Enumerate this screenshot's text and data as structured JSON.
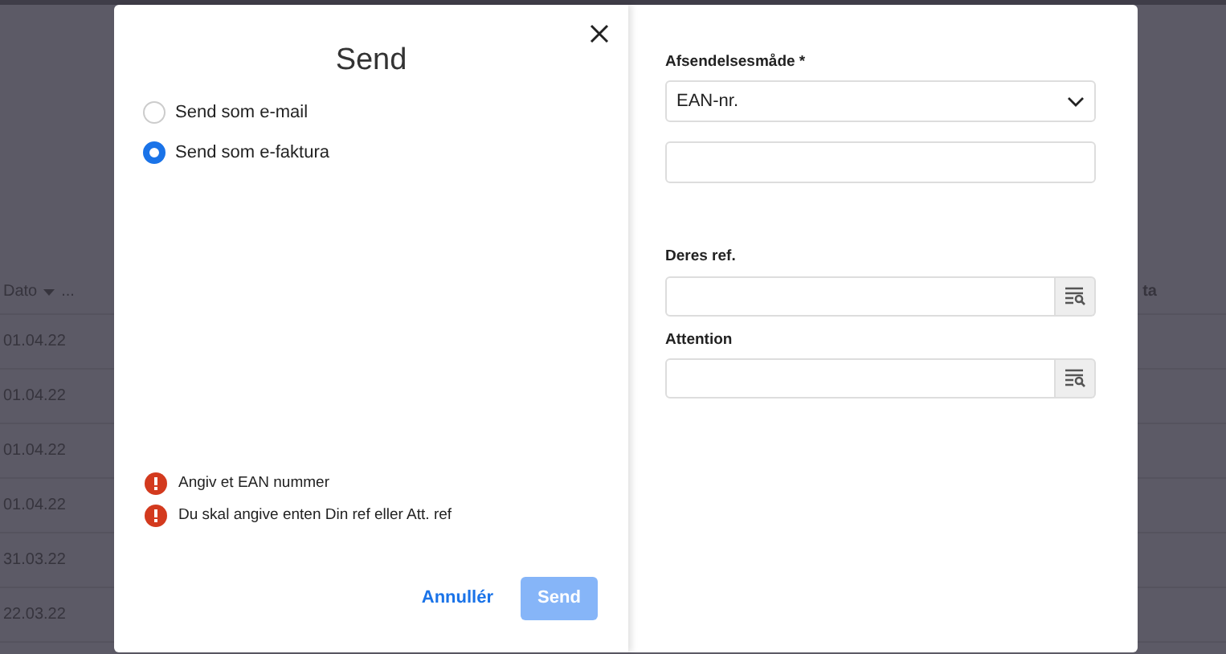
{
  "background_table": {
    "column_1_header": "Dato",
    "column_1_more": "...",
    "column_2_header": "ta",
    "rows": [
      "01.04.22",
      "01.04.22",
      "01.04.22",
      "01.04.22",
      "31.03.22",
      "22.03.22"
    ]
  },
  "dialog": {
    "title": "Send",
    "options": [
      {
        "label": "Send som e-mail",
        "selected": false
      },
      {
        "label": "Send som e-faktura",
        "selected": true
      }
    ],
    "errors": [
      "Angiv et EAN nummer",
      "Du skal angive enten Din ref eller Att. ref"
    ],
    "buttons": [
      {
        "kind": "link",
        "label": "Annullér",
        "disabled": false
      },
      {
        "kind": "primary",
        "label": "Send",
        "disabled": true
      }
    ],
    "method": {
      "label": "Afsendelsesmåde *",
      "value": "EAN-nr."
    },
    "lookups": [
      {
        "label": "Deres ref."
      },
      {
        "label": "Attention"
      }
    ]
  }
}
